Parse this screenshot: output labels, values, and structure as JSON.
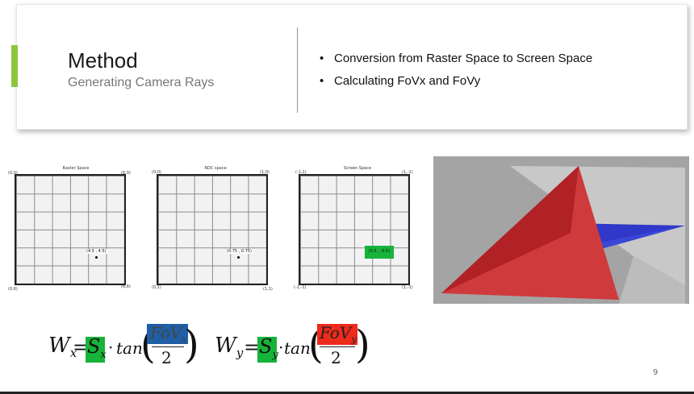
{
  "header": {
    "title": "Method",
    "subtitle": "Generating Camera Rays",
    "bullets": [
      "Conversion from Raster Space to Screen Space",
      "Calculating FoVx and FoVy"
    ],
    "accent_color": "#8cc63f"
  },
  "panels": [
    {
      "title": "Raster Space",
      "corners": {
        "tl": "(0,0)",
        "tr": "(6,0)",
        "bl": "(0,6)",
        "br": "(6,6)"
      },
      "point_label": "(4.5 , 4.5)"
    },
    {
      "title": "NDC space",
      "corners": {
        "tl": "(0,0)",
        "tr": "(1,0)",
        "bl": "(0,1)",
        "br": "(1,1)"
      },
      "point_label": "(0.75 , 0.75)"
    },
    {
      "title": "Screen Space",
      "corners": {
        "tl": "(-1,1)",
        "tr": "(1,-1)",
        "bl": "(-1,-1)",
        "br": "(1,-1)"
      },
      "point_label": "(0.5 , -0.5)"
    }
  ],
  "equations": {
    "wx": {
      "lhs": "W",
      "sub": "x",
      "eq": "=",
      "s": "S",
      "s_sub": "x",
      "op": "·",
      "fn": "tan",
      "num": "FoV",
      "num_sub": "x",
      "den": "2"
    },
    "wy": {
      "lhs": "W",
      "sub": "y",
      "eq": "=",
      "s": "S",
      "s_sub": "y",
      "op": "·",
      "fn": "tan",
      "num": "FoV",
      "num_sub": "y",
      "den": "2"
    }
  },
  "colors": {
    "green_highlight": "#17b33a",
    "blue_highlight": "#1f5fa6",
    "red_highlight": "#ee2a1b"
  },
  "page_number": "9"
}
